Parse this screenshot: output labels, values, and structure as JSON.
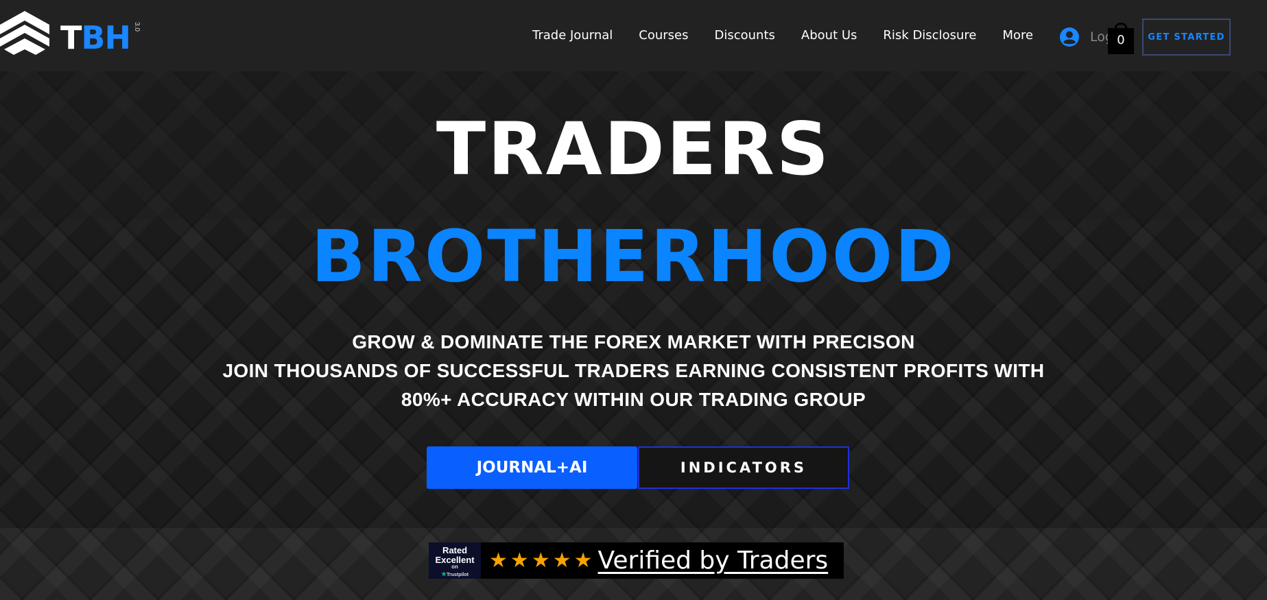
{
  "header": {
    "logo": {
      "text_t": "T",
      "text_bh": "BH",
      "small_mark": "3.0"
    },
    "nav": [
      {
        "label": "Trade Journal"
      },
      {
        "label": "Courses"
      },
      {
        "label": "Discounts"
      },
      {
        "label": "About Us"
      },
      {
        "label": "Risk Disclosure"
      },
      {
        "label": "More"
      }
    ],
    "login_label": "Log In",
    "cart_count": "0",
    "cta_label": "GET STARTED"
  },
  "hero": {
    "title_line1": "TRADERS",
    "title_line2": "BROTHERHOOD",
    "subtitle_line1": "GROW & DOMINATE THE FOREX MARKET WITH PRECISON",
    "subtitle_line2": "JOIN THOUSANDS OF SUCCESSFUL TRADERS EARNING CONSISTENT PROFITS WITH",
    "subtitle_line3": "80%+ ACCURACY WITHIN OUR TRADING GROUP",
    "primary_button": "JOURNAL+AI",
    "secondary_button": "INDICATORS"
  },
  "trust": {
    "badge_line1": "Rated",
    "badge_line2": "Excellent",
    "badge_line3": "on",
    "badge_brand": "Trustpilot",
    "stars": [
      "★",
      "★",
      "★",
      "★",
      "★"
    ],
    "verified_text": "Verified by Traders"
  },
  "colors": {
    "accent_blue": "#0a84ff",
    "button_blue": "#0a5fff",
    "star_gold": "#f5a300",
    "header_bg": "#222222"
  }
}
